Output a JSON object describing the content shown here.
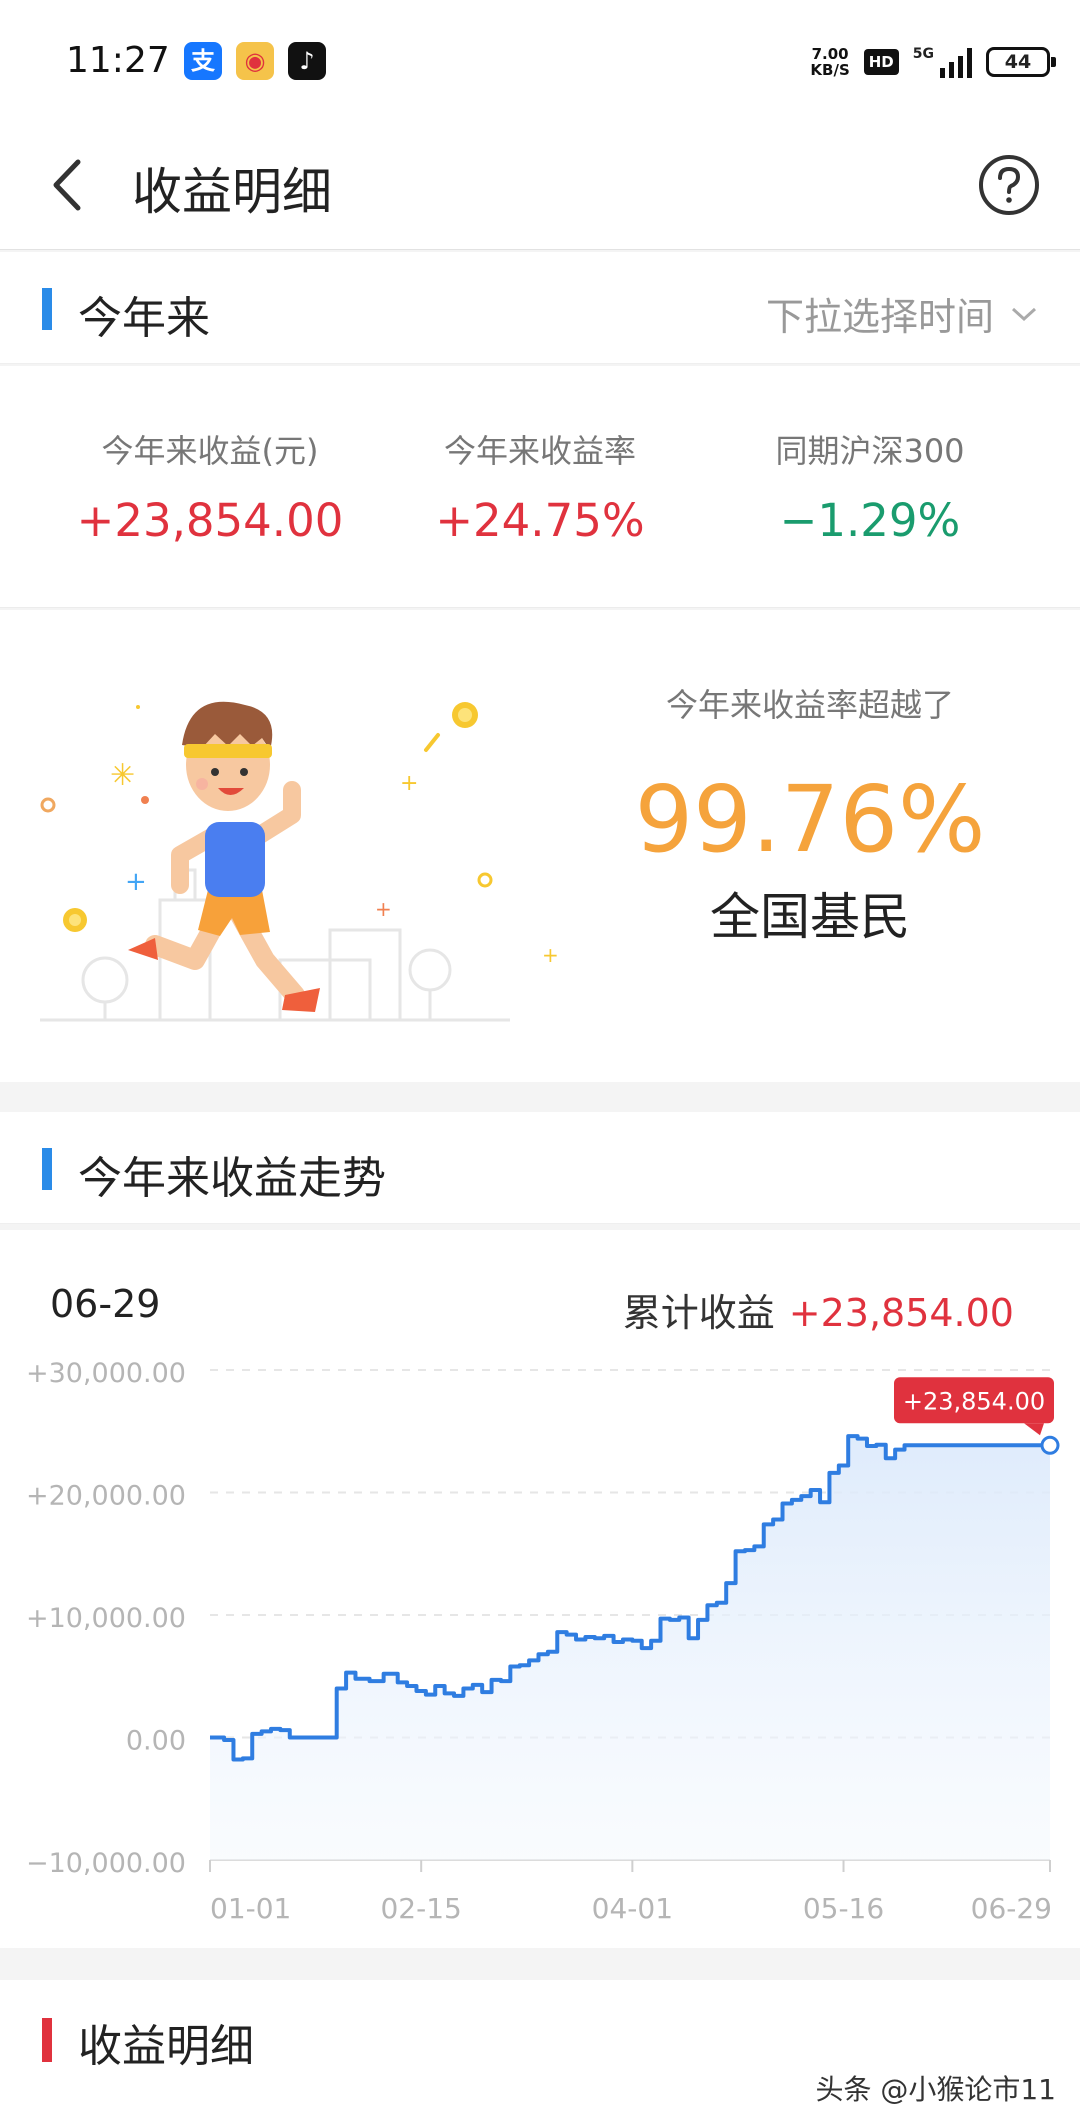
{
  "status_bar": {
    "time": "11:27",
    "apps": [
      {
        "name": "alipay-icon",
        "glyph": "支",
        "color": "#1677ff"
      },
      {
        "name": "weibo-icon",
        "glyph": "◉",
        "color": "#f5a623"
      },
      {
        "name": "tiktok-icon",
        "glyph": "♪",
        "color": "#111111"
      }
    ],
    "net_speed_value": "7.00",
    "net_speed_unit": "KB/S",
    "hd_label": "HD",
    "network_label": "5G",
    "battery": "44"
  },
  "nav": {
    "title": "收益明细"
  },
  "period_section": {
    "title": "今年来",
    "select_label": "下拉选择时间",
    "accent": "#2a8be8"
  },
  "stats": [
    {
      "label": "今年来收益(元)",
      "value": "+23,854.00",
      "tone": "red"
    },
    {
      "label": "今年来收益率",
      "value": "+24.75%",
      "tone": "red"
    },
    {
      "label": "同期沪深300",
      "value": "−1.29%",
      "tone": "green"
    }
  ],
  "rank": {
    "line1": "今年来收益率超越了",
    "percent": "99.76%",
    "line2": "全国基民"
  },
  "trend_section": {
    "title": "今年来收益走势",
    "accent": "#2a8be8"
  },
  "chart_header": {
    "date": "06-29",
    "total_label": "累计收益",
    "total_value": "+23,854.00"
  },
  "chart_data": {
    "type": "area",
    "ylim": [
      -10000,
      30000
    ],
    "y_ticks": [
      {
        "value": 30000,
        "label": "+30,000.00"
      },
      {
        "value": 20000,
        "label": "+20,000.00"
      },
      {
        "value": 10000,
        "label": "+10,000.00"
      },
      {
        "value": 0,
        "label": "0.00"
      },
      {
        "value": -10000,
        "label": "−10,000.00"
      }
    ],
    "x_ticks": [
      {
        "value": 0,
        "label": "01-01"
      },
      {
        "value": 45,
        "label": "02-15"
      },
      {
        "value": 90,
        "label": "04-01"
      },
      {
        "value": 135,
        "label": "05-16"
      },
      {
        "value": 179,
        "label": "06-29"
      }
    ],
    "x_range": [
      0,
      179
    ],
    "line_color": "#2f7de1",
    "callout": "+23,854.00",
    "callout_color": "#e0323e",
    "series": [
      {
        "x": [
          0,
          3,
          5,
          7,
          9,
          11,
          13,
          15,
          17,
          19,
          21,
          23,
          25,
          27,
          29,
          31,
          34,
          37,
          40,
          42,
          44,
          46,
          48,
          50,
          52,
          54,
          56,
          58,
          60,
          62,
          64,
          66,
          68,
          70,
          72,
          74,
          76,
          78,
          80,
          82,
          84,
          86,
          88,
          90,
          92,
          94,
          96,
          98,
          100,
          102,
          104,
          106,
          108,
          110,
          112,
          114,
          116,
          118,
          120,
          122,
          124,
          126,
          128,
          130,
          132,
          134,
          136,
          138,
          140,
          142,
          144,
          146,
          148,
          150,
          152,
          154,
          156,
          158,
          160,
          162,
          164,
          166,
          168,
          170,
          172,
          174,
          176,
          178,
          179
        ],
        "y": [
          0,
          -200,
          -1800,
          -1700,
          300,
          500,
          700,
          600,
          0,
          0,
          0,
          0,
          0,
          4000,
          5300,
          4800,
          4600,
          5200,
          4500,
          4200,
          3800,
          3500,
          4200,
          3600,
          3400,
          4000,
          4300,
          3700,
          4700,
          4600,
          5800,
          5900,
          6300,
          6800,
          7000,
          8600,
          8400,
          8000,
          8200,
          8100,
          8300,
          7800,
          8000,
          7900,
          7300,
          7900,
          9700,
          9600,
          9800,
          8100,
          9600,
          10800,
          11000,
          12600,
          15200,
          15300,
          15600,
          17400,
          17800,
          19100,
          19400,
          19700,
          20200,
          19200,
          21600,
          22200,
          24600,
          24400,
          23800,
          23900,
          22800,
          23500,
          23854,
          23854,
          23854,
          23854,
          23854,
          23854,
          23854,
          23854,
          23854,
          23854,
          23854,
          23854,
          23854,
          23854,
          23854,
          23854,
          23854
        ]
      }
    ]
  },
  "detail_section": {
    "title": "收益明细",
    "accent": "#e0323e"
  },
  "watermark": "头条 @小猴论市11"
}
